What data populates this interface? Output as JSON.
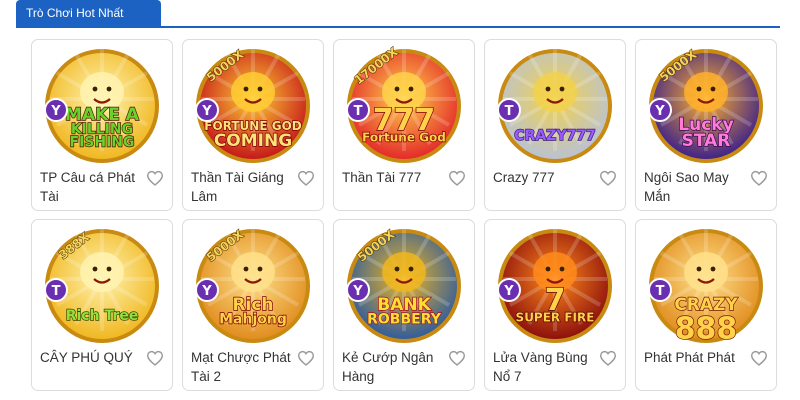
{
  "section": {
    "title": "Trò Chơi Hot Nhất"
  },
  "colors": {
    "accent": "#1b62c2",
    "heart": "#9a9a9a"
  },
  "games": [
    {
      "title": "TP Câu cá Phát Tài",
      "logo_lines": [
        "MAKE A",
        "KILLING",
        "FISHING"
      ],
      "badge_letter": "Y",
      "bg": "#f0b61e",
      "bg2": "#fff3b0",
      "text_color": "#6bd12f",
      "stroke": "#4a1c00",
      "icon": "killing-fishing-game-icon"
    },
    {
      "title": "Thần Tài Giáng Lâm",
      "logo_lines": [
        "FORTUNE GOD",
        "COMING"
      ],
      "multiplier": "5000X",
      "badge_letter": "Y",
      "bg": "#c4141a",
      "bg2": "#ffcc33",
      "text_color": "#ffe27a",
      "stroke": "#7a0000",
      "icon": "fortune-god-coming-game-icon"
    },
    {
      "title": "Thần Tài 777",
      "logo_lines": [
        "777",
        "Fortune God"
      ],
      "multiplier": "17000X",
      "badge_letter": "T",
      "bg": "#e3252a",
      "bg2": "#ffd24a",
      "text_color": "#ffd24a",
      "stroke": "#7a0000",
      "icon": "fortune-god-777-game-icon"
    },
    {
      "title": "Crazy 777",
      "logo_lines": [
        "CRAZY777"
      ],
      "badge_letter": "T",
      "bg": "#b8c2d6",
      "bg2": "#f2d14b",
      "text_color": "#9b5bff",
      "stroke": "#3a1a7a",
      "icon": "crazy-777-game-icon"
    },
    {
      "title": "Ngôi Sao May Mắn",
      "logo_lines": [
        "Lucky",
        "STAR"
      ],
      "multiplier": "5000X",
      "badge_letter": "Y",
      "bg": "#3a1f8c",
      "bg2": "#ffb02a",
      "text_color": "#ff7ad9",
      "stroke": "#3b0a52",
      "icon": "lucky-star-game-icon"
    },
    {
      "title": "CÂY PHÚ QUÝ",
      "logo_lines": [
        "Rich Tree"
      ],
      "multiplier": "388X",
      "badge_letter": "T",
      "bg": "#f0b61e",
      "bg2": "#fff3b0",
      "text_color": "#93e23c",
      "stroke": "#3a4a00",
      "icon": "rich-tree-game-icon"
    },
    {
      "title": "Mạt Chược Phát Tài 2",
      "logo_lines": [
        "Rich",
        "Mahjong"
      ],
      "multiplier": "5000X",
      "badge_letter": "Y",
      "bg": "#e08b1d",
      "bg2": "#ffe08a",
      "text_color": "#ffd24a",
      "stroke": "#7a0000",
      "icon": "rich-mahjong-game-icon"
    },
    {
      "title": "Kẻ Cướp Ngân Hàng",
      "logo_lines": [
        "BANK",
        "ROBBERY"
      ],
      "multiplier": "5000X",
      "badge_letter": "Y",
      "bg": "#2c5aa0",
      "bg2": "#f0b61e",
      "text_color": "#ffdd33",
      "stroke": "#b0101a",
      "icon": "bank-robbery-game-icon"
    },
    {
      "title": "Lửa Vàng Bùng Nổ 7",
      "logo_lines": [
        "7",
        "SUPER FIRE"
      ],
      "badge_letter": "Y",
      "bg": "#8a0d0d",
      "bg2": "#ff8a1a",
      "text_color": "#ffd24a",
      "stroke": "#5a0000",
      "icon": "super-fire-game-icon"
    },
    {
      "title": "Phát Phát Phát",
      "logo_lines": [
        "CRAZY",
        "888"
      ],
      "badge_letter": "T",
      "bg": "#e08b1d",
      "bg2": "#ffe08a",
      "text_color": "#ffd24a",
      "stroke": "#7a1a00",
      "icon": "crazy-888-game-icon"
    }
  ]
}
